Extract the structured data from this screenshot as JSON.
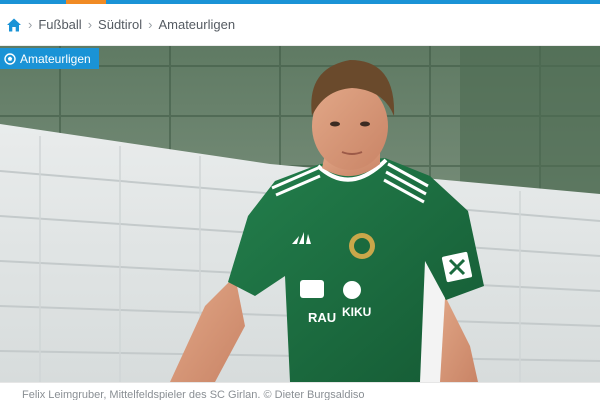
{
  "colors": {
    "accent": "#1a93d6",
    "tab_accent": "#f08a24",
    "jersey": "#1e7a45"
  },
  "breadcrumb": {
    "home_icon": "home-icon",
    "items": [
      "Fußball",
      "Südtirol",
      "Amateurligen"
    ]
  },
  "hero": {
    "badge_label": "Amateurligen",
    "badge_icon": "soccer-ball-icon",
    "jersey_brand": "KIKU",
    "jersey_sponsor": "RAU"
  },
  "caption": {
    "text": "Felix Leimgruber, Mittelfeldspieler des SC Girlan. © Dieter Burgsaldiso"
  }
}
